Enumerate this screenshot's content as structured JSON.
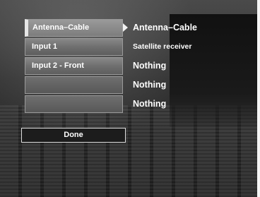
{
  "inputs": [
    {
      "label": "Antenna–Cable",
      "selected": true
    },
    {
      "label": "Input 1",
      "selected": false
    },
    {
      "label": "Input 2 - Front",
      "selected": false
    },
    {
      "label": "",
      "selected": false
    },
    {
      "label": "",
      "selected": false
    }
  ],
  "sources": [
    "Antenna–Cable",
    "Satellite receiver",
    "Nothing",
    "Nothing",
    "Nothing"
  ],
  "done_label": "Done",
  "icons": {
    "selection_arrow": "arrow-right-icon"
  }
}
